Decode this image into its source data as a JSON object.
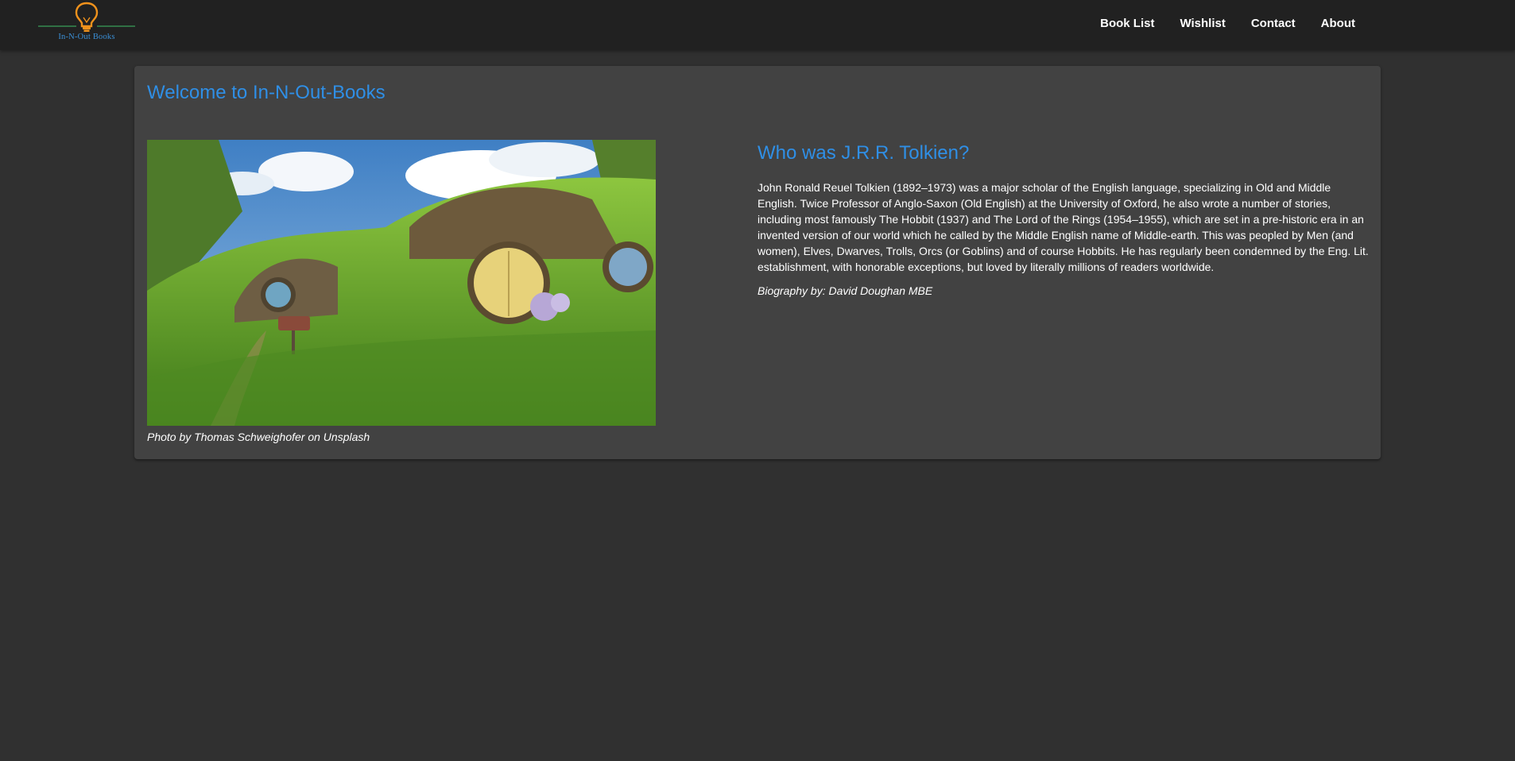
{
  "app": {
    "logo_text": "In-N-Out Books",
    "brand_color": "#2f8fe6",
    "accent_color": "#f0921c"
  },
  "nav": {
    "items": [
      {
        "label": "Book List"
      },
      {
        "label": "Wishlist"
      },
      {
        "label": "Contact"
      },
      {
        "label": "About"
      }
    ]
  },
  "main": {
    "title": "Welcome to In-N-Out-Books",
    "photo_caption": "Photo by Thomas Schweighofer on Unsplash",
    "bio": {
      "title": "Who was J.R.R. Tolkien?",
      "text": "John Ronald Reuel Tolkien (1892–1973) was a major scholar of the English language, specializing in Old and Middle English. Twice Professor of Anglo-Saxon (Old English) at the University of Oxford, he also wrote a number of stories, including most famously The Hobbit (1937) and The Lord of the Rings (1954–1955), which are set in a pre-historic era in an invented version of our world which he called by the Middle English name of Middle-earth. This was peopled by Men (and women), Elves, Dwarves, Trolls, Orcs (or Goblins) and of course Hobbits. He has regularly been condemned by the Eng. Lit. establishment, with honorable exceptions, but loved by literally millions of readers worldwide.",
      "credit": "Biography by: David Doughan MBE"
    }
  }
}
